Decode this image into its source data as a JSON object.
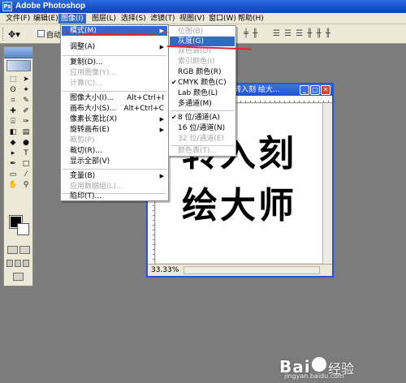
{
  "app": {
    "title": "Adobe Photoshop",
    "icon": "photoshop-app-icon"
  },
  "menubar": [
    "文件(F)",
    "编辑(E)",
    "图像(I)",
    "图层(L)",
    "选择(S)",
    "滤镜(T)",
    "视图(V)",
    "窗口(W)",
    "帮助(H)"
  ],
  "menubar_active": "图像(I)",
  "options": {
    "auto_select_label": "自动",
    "tool_icon": "move-tool-icon"
  },
  "document": {
    "title": "转入刻  绘大...",
    "line1": "转入刻",
    "line2": "绘大师",
    "zoom": "33.33%"
  },
  "image_menu": {
    "items": [
      {
        "label": "模式(M)",
        "submenu": true,
        "state": "highlighted"
      },
      {
        "label": "调整(A)",
        "submenu": true
      },
      {
        "label": "复制(D)..."
      },
      {
        "label": "应用图像(Y)...",
        "disabled": true
      },
      {
        "label": "计算(C)...",
        "disabled": true
      },
      {
        "label": "图像大小(I)...",
        "shortcut": "Alt+Ctrl+I"
      },
      {
        "label": "画布大小(S)...",
        "shortcut": "Alt+Ctrl+C"
      },
      {
        "label": "像素长宽比(X)",
        "submenu": true
      },
      {
        "label": "旋转画布(E)",
        "submenu": true
      },
      {
        "label": "裁剪(P)",
        "disabled": true
      },
      {
        "label": "裁切(R)..."
      },
      {
        "label": "显示全部(V)"
      },
      {
        "label": "变量(B)",
        "submenu": true
      },
      {
        "label": "应用数据组(L)...",
        "disabled": true
      },
      {
        "label": "陷印(T)..."
      }
    ]
  },
  "mode_submenu": {
    "items": [
      {
        "label": "位图(B)",
        "disabled": true
      },
      {
        "label": "灰度(G)",
        "state": "highlighted"
      },
      {
        "label": "双色调(D)",
        "disabled": true
      },
      {
        "label": "索引颜色(I)",
        "disabled": true
      },
      {
        "label": "RGB 颜色(R)"
      },
      {
        "label": "CMYK 颜色(C)",
        "checked": true
      },
      {
        "label": "Lab 颜色(L)"
      },
      {
        "label": "多通道(M)"
      },
      {
        "label": "8 位/通道(A)",
        "checked": true
      },
      {
        "label": "16 位/通道(N)"
      },
      {
        "label": "32 位/通道(E)",
        "disabled": true
      },
      {
        "label": "颜色表(T)...",
        "disabled": true
      }
    ]
  },
  "watermark": {
    "logo": "Bai",
    "suffix": "经验",
    "url": "jingyan.baidu.com"
  }
}
